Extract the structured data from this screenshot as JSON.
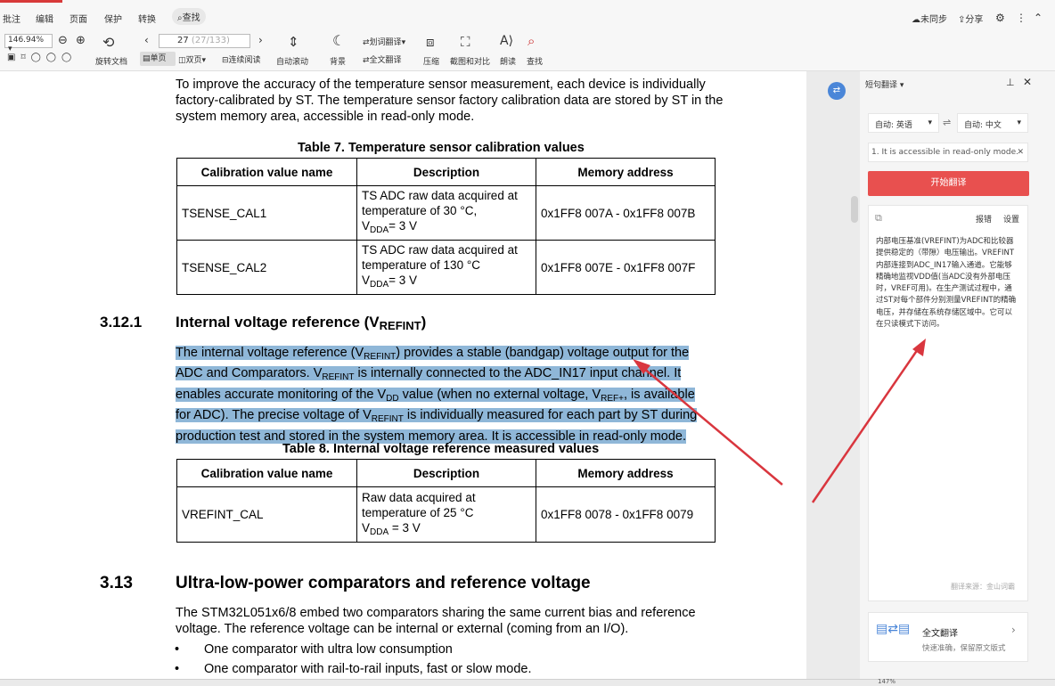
{
  "menu": [
    "批注",
    "编辑",
    "页面",
    "保护",
    "转换"
  ],
  "search_label": "查找",
  "top_right": {
    "sync": "未同步",
    "share": "分享"
  },
  "toolbar": {
    "zoom": "146.94%",
    "rotate": "旋转文档",
    "page_current": "27",
    "page_total": "(27/133)",
    "single": "单页",
    "double": "双页",
    "continuous": "连续阅读",
    "autoscroll": "自动滚动",
    "background": "背景",
    "word_translate": "划词翻译",
    "full_translate": "全文翻译",
    "compress": "压缩",
    "screenshot": "截图和对比",
    "read_aloud": "朗读",
    "find": "查找"
  },
  "doc": {
    "intro": "To improve the accuracy of the temperature sensor measurement, each device is individually factory-calibrated by ST. The temperature sensor factory calibration data are stored by ST in the system memory area, accessible in read-only mode.",
    "table7": {
      "title": "Table 7. Temperature sensor calibration values",
      "headers": [
        "Calibration value name",
        "Description",
        "Memory address"
      ],
      "rows": [
        {
          "name": "TSENSE_CAL1",
          "desc1": "TS ADC raw data acquired at",
          "desc2": "temperature of 30 °C,",
          "vdda": "V",
          "vsub": "DDA",
          "veq": "= 3 V",
          "addr": "0x1FF8 007A - 0x1FF8 007B"
        },
        {
          "name": "TSENSE_CAL2",
          "desc1": "TS ADC raw data acquired at",
          "desc2": "temperature of 130 °C",
          "vdda": "V",
          "vsub": "DDA",
          "veq": "= 3 V",
          "addr": "0x1FF8 007E - 0x1FF8 007F"
        }
      ]
    },
    "sec_3121_num": "3.12.1",
    "sec_3121_title": "Internal voltage reference (V",
    "sec_3121_sub": "REFINT",
    "sec_3121_close": ")",
    "hl_line1_a": "The internal voltage reference (V",
    "hl_line1_sub": "REFINT",
    "hl_line1_b": ") provides a stable (bandgap) voltage output for the",
    "hl_line2_a": "ADC and Comparators. V",
    "hl_line2_sub": "REFINT",
    "hl_line2_b": " is internally connected to the ADC_IN17 input channel. It",
    "hl_line3_a": "enables accurate monitoring of the V",
    "hl_line3_sub": "DD",
    "hl_line3_b": " value (when no external voltage, V",
    "hl_line3_sub2": "REF+",
    "hl_line3_c": ", is available",
    "hl_line4_a": "for ADC). The precise voltage of V",
    "hl_line4_sub": "REFINT",
    "hl_line4_b": " is individually measured for each part by ST during",
    "hl_line5": "production test and stored in the system memory area. It is accessible in read-only mode.",
    "table8": {
      "title": "Table 8. Internal voltage reference measured values",
      "headers": [
        "Calibration value name",
        "Description",
        "Memory address"
      ],
      "rows": [
        {
          "name": "VREFINT_CAL",
          "desc1": "Raw data acquired at",
          "desc2": "temperature of 25 °C",
          "vdda": "V",
          "vsub": "DDA",
          "veq": " = 3 V",
          "addr": "0x1FF8 0078 - 0x1FF8 0079"
        }
      ]
    },
    "sec_313_num": "3.13",
    "sec_313_title": "Ultra-low-power comparators and reference voltage",
    "p313": "The STM32L051x6/8 embed two comparators sharing the same current bias and reference voltage. The reference voltage can be internal or external (coming from an I/O).",
    "bullets": [
      "One comparator with ultra low consumption",
      "One comparator with rail-to-rail inputs, fast or slow mode."
    ]
  },
  "side": {
    "title": "短句翻译",
    "src_lang": "自动: 英语",
    "dst_lang": "自动: 中文",
    "input": "1. It is accessible in read-only mode.",
    "start": "开始翻译",
    "report": "报错",
    "settings": "设置",
    "result": "内部电压基准(VREFINT)为ADC和比较器提供稳定的（带隙）电压输出。VREFINT内部连接到ADC_IN17输入通道。它能够精确地监视VDD值(当ADC没有外部电压时，VREF可用)。在生产测试过程中，通过ST对每个部件分别测量VREFINT的精确电压，并存储在系统存储区域中。它可以在只读模式下访问。",
    "source": "翻译来源：金山词霸",
    "full_title": "全文翻译",
    "full_sub": "快速准确，保留原文版式"
  },
  "status": {
    "zoom": "147%"
  },
  "colors": {
    "start_button": "#e8504f",
    "highlight": "#8fb7d8",
    "arrow": "#d9363e"
  }
}
